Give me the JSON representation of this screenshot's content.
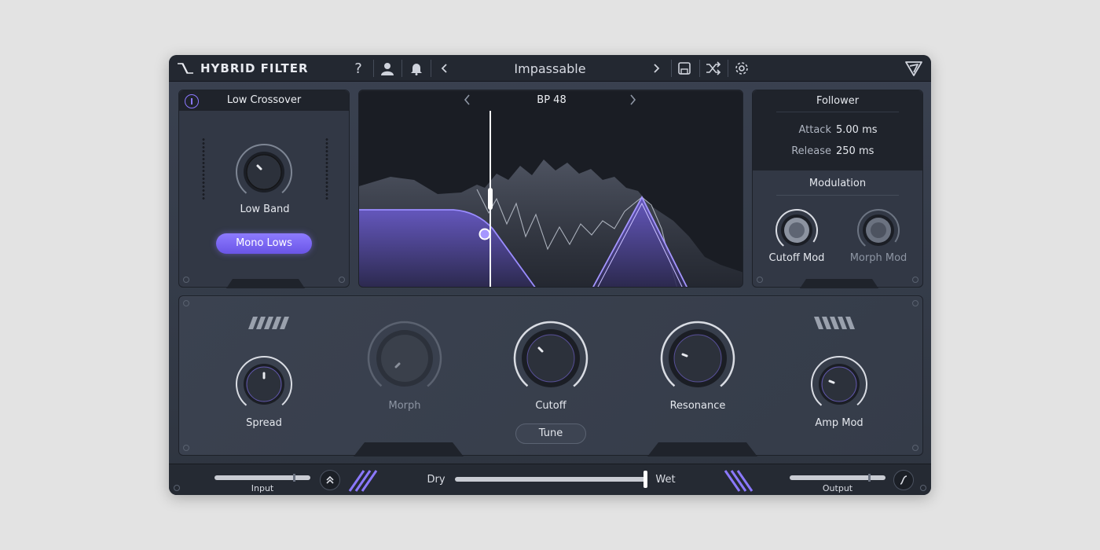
{
  "header": {
    "logo_text": "HYBRID FILTER",
    "preset_name": "Impassable",
    "icons": [
      "help-icon",
      "user-icon",
      "bell-icon",
      "chevron-left-icon",
      "chevron-right-icon",
      "save-icon",
      "shuffle-icon",
      "gear-icon",
      "brand-logo-icon"
    ]
  },
  "low_crossover": {
    "title": "Low Crossover",
    "knob_label": "Low Band",
    "button_label": "Mono Lows"
  },
  "display": {
    "filter_type": "BP 48"
  },
  "follower": {
    "title": "Follower",
    "attack_label": "Attack",
    "attack_value": "5.00 ms",
    "release_label": "Release",
    "release_value": "250 ms"
  },
  "modulation": {
    "title": "Modulation",
    "cutoff_mod_label": "Cutoff Mod",
    "morph_mod_label": "Morph Mod"
  },
  "main": {
    "spread_label": "Spread",
    "morph_label": "Morph",
    "cutoff_label": "Cutoff",
    "resonance_label": "Resonance",
    "amp_mod_label": "Amp Mod",
    "tune_label": "Tune"
  },
  "footer": {
    "input_label": "Input",
    "output_label": "Output",
    "dry_label": "Dry",
    "wet_label": "Wet",
    "dry_wet": 1.0
  },
  "colors": {
    "accent": "#8b78ff",
    "panel": "#323845",
    "header": "#232831"
  }
}
